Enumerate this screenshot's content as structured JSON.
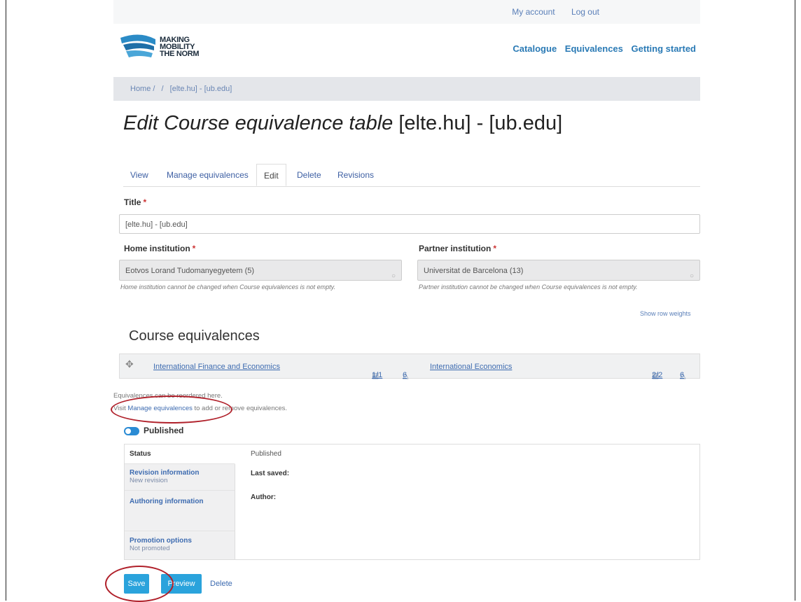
{
  "top_links": {
    "my_account": "My account",
    "log_out": "Log out"
  },
  "logo": {
    "line1": "MAKING",
    "line2": "MOBILITY",
    "line3": "THE NORM"
  },
  "main_nav": {
    "catalogue": "Catalogue",
    "equivalences": "Equivalences",
    "getting_started": "Getting started"
  },
  "breadcrumb": {
    "home": "Home /",
    "sep": "/",
    "current": "[elte.hu] - [ub.edu]"
  },
  "page_title": {
    "italic": "Edit Course equivalence table",
    "rest": "[elte.hu] - [ub.edu]"
  },
  "tabs": {
    "view": "View",
    "manage": "Manage equivalences",
    "edit": "Edit",
    "delete": "Delete",
    "revisions": "Revisions"
  },
  "form": {
    "title_label": "Title",
    "required_mark": "*",
    "title_value": "[elte.hu] - [ub.edu]",
    "home_label": "Home institution",
    "home_value": "Eotvos Lorand Tudomanyegyetem (5)",
    "home_help": "Home institution cannot be changed when Course equivalences is not empty.",
    "partner_label": "Partner institution",
    "partner_value": "Universitat de Barcelona (13)",
    "partner_help": "Partner institution cannot be changed when Course equivalences is not empty.",
    "show_row_weights": "Show row weights"
  },
  "equivalences": {
    "heading": "Course equivalences",
    "row": {
      "left_course": "International Finance and Economics",
      "left_count": "1/1",
      "left_credits": "6",
      "right_course": "International Economics",
      "right_count": "2/2",
      "right_credits": "6"
    },
    "note1": "Equivalences can be reordered here.",
    "note2_pre": "Visit",
    "note2_link": "Manage equivalences",
    "note2_post": "to add or remove equivalences."
  },
  "published_label": "Published",
  "vertical_tabs": {
    "status": {
      "title": "Status"
    },
    "revision": {
      "title": "Revision information",
      "sub": "New revision"
    },
    "authoring": {
      "title": "Authoring information"
    },
    "promotion": {
      "title": "Promotion options",
      "sub": "Not promoted"
    },
    "content_published": "Published",
    "last_saved": "Last saved:",
    "author": "Author:"
  },
  "buttons": {
    "save": "Save",
    "preview": "Preview",
    "delete": "Delete"
  },
  "colors": {
    "accent": "#2aa3dc",
    "link": "#3d6bb0",
    "annotation": "#b0202a"
  }
}
